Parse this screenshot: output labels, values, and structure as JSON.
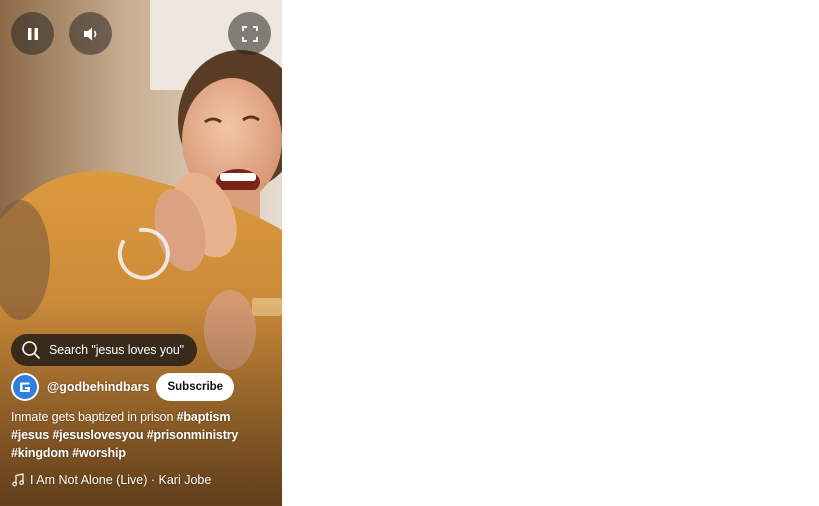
{
  "controls": {
    "pause_icon": "pause-icon",
    "volume_icon": "volume-icon",
    "fullscreen_icon": "fullscreen-icon"
  },
  "search": {
    "icon": "search-icon",
    "text": "Search \"jesus loves you\""
  },
  "channel": {
    "avatar_icon": "channel-logo",
    "handle": "@godbehindbars",
    "subscribe_label": "Subscribe",
    "avatar_color": "#2f7fe0"
  },
  "description": {
    "text": "Inmate gets baptized in prison",
    "hashtags": [
      "#baptism",
      "#jesus",
      "#jesuslovesyou",
      "#prisonministry",
      "#kingdom",
      "#worship"
    ]
  },
  "music": {
    "icon": "music-note-icon",
    "track": "I Am Not Alone (Live) · Kari Jobe"
  },
  "colors": {
    "page_background": "#ffffff",
    "subscribe_bg": "#ffffff",
    "overlay_text": "#ffffff"
  }
}
